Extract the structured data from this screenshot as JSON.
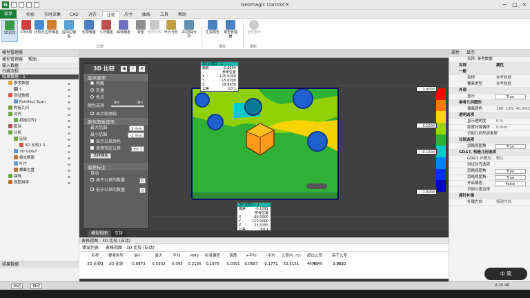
{
  "app": {
    "title": "Geomagic Control X",
    "logo_letter": "G"
  },
  "tabs": [
    {
      "label": "菜单"
    },
    {
      "label": "初始"
    },
    {
      "label": "实时采集"
    },
    {
      "label": "CAD"
    },
    {
      "label": "对齐"
    },
    {
      "label": "比较"
    },
    {
      "label": "尺寸"
    },
    {
      "label": "曲线"
    },
    {
      "label": "工具"
    },
    {
      "label": "帮助"
    }
  ],
  "ribbon": {
    "buttons": [
      {
        "label": "3D比较",
        "icon": "compare-3d-icon"
      },
      {
        "label": "2D比较",
        "icon": "compare-2d-icon"
      },
      {
        "label": "比较点",
        "icon": "compare-point-icon"
      },
      {
        "label": "边界偏差",
        "icon": "boundary-deviation-icon"
      },
      {
        "label": "虚拟边偏差",
        "icon": "virtual-edge-icon"
      },
      {
        "label": "轮廓偏差",
        "icon": "contour-deviation-icon"
      },
      {
        "label": "几何偏差",
        "icon": "geometry-deviation-icon"
      },
      {
        "label": "曲线偏差",
        "icon": "curve-deviation-icon"
      },
      {
        "label": "钣金",
        "icon": "sheet-metal-icon"
      },
      {
        "label": "趋势比较",
        "icon": "trend-icon"
      },
      {
        "label": "叶片分析",
        "icon": "blade-icon"
      },
      {
        "label": "2D扭曲分析",
        "icon": "twist-icon"
      },
      {
        "label": "生成报告",
        "icon": "report-icon"
      },
      {
        "label": "报告管理器",
        "icon": "report-manager-icon"
      },
      {
        "label": "全部重新",
        "icon": "refresh-icon"
      }
    ],
    "groups": {
      "compare": "比较",
      "report": "报告",
      "update": "更新"
    }
  },
  "left_panel": {
    "title": "模型管理器",
    "tools": {
      "manager": "模型管理器",
      "help": "帮助"
    },
    "sections": [
      "输入数据",
      "扫描流程",
      "结果数据 - 1"
    ],
    "tree": [
      {
        "label": "参考数据",
        "level": 1,
        "color": "#d9a13b"
      },
      {
        "label": "1",
        "level": 2,
        "color": "#888888"
      },
      {
        "label": "测试数据",
        "level": 1,
        "color": "#d9534f"
      },
      {
        "label": "Partifact Scan",
        "level": 2,
        "color": "#5b9bd5"
      },
      {
        "label": "构造几何",
        "level": 1,
        "color": "#7a9a3a"
      },
      {
        "label": "对齐",
        "level": 1,
        "color": "#6ea845"
      },
      {
        "label": "初始对齐1",
        "level": 2,
        "color": "#6ea845"
      },
      {
        "label": "配对",
        "level": 1,
        "color": "#aa5555"
      },
      {
        "label": "分析",
        "level": 1,
        "color": "#6ea845"
      },
      {
        "label": "比较",
        "level": 2,
        "color": "#6ea845"
      },
      {
        "label": "3D 比较1",
        "level": 3,
        "color": "#d9534f",
        "suffix": "3"
      },
      {
        "label": "3D GD&T",
        "level": 2,
        "color": "#5b9bd5"
      },
      {
        "label": "相交断面",
        "level": 2,
        "color": "#c07030"
      },
      {
        "label": "叶片",
        "level": 2,
        "color": "#5b9bd5"
      },
      {
        "label": "横截位置",
        "level": 2,
        "color": "#c07030"
      },
      {
        "label": "曲线",
        "level": 1,
        "color": "#6ea845"
      },
      {
        "label": "视图排序",
        "level": 1,
        "color": "#c07030"
      }
    ],
    "bottom_title": "结果数据"
  },
  "compare_panel": {
    "title": "3D 比较",
    "display_header": "显示选项",
    "display_options": [
      {
        "label": "色图",
        "selected": true
      },
      {
        "label": "矢量",
        "selected": false
      },
      {
        "label": "色点",
        "selected": false
      }
    ],
    "color_steps_label": "颜色选项",
    "slider_min": "最小",
    "slider_max": "最大",
    "show_contour": "显示轮廓线",
    "color_header": "颜色面板选项",
    "max_range_label": "最大范围",
    "max_range": "1 mm",
    "min_range_label": "最小范围",
    "min_range": "-1 mm",
    "show_tolerance": "显示公差颜色",
    "use_tolerance": "使用指定公差",
    "tolerance_value": "±0.1",
    "select_template": "选择模板",
    "annotation_header": "偏差标注",
    "auto_label": "自动",
    "above_tol": "高于公差的数量",
    "below_tol": "低于公差的数量",
    "above_val": "0",
    "below_val": "0"
  },
  "callouts": [
    {
      "title": "3D 比较1 - 1",
      "rows": [
        {
          "k": "偏差",
          "v": "-0.0604"
        },
        {
          "k": "",
          "v": "参考位置"
        },
        {
          "k": "X",
          "v": "-125.0000"
        },
        {
          "k": "Y",
          "v": "-15.0000"
        },
        {
          "k": "Z",
          "v": "29.9658"
        },
        {
          "k": "公差",
          "v": "±0.1"
        }
      ]
    },
    {
      "title": "3D 比较1 - 2",
      "rows": [
        {
          "k": "偏差",
          "v": "-0.1091"
        },
        {
          "k": "",
          "v": "参考位置"
        },
        {
          "k": "X",
          "v": "-90.0000"
        },
        {
          "k": "Y",
          "v": "-110.0000"
        },
        {
          "k": "Z",
          "v": "21.3155"
        },
        {
          "k": "公差",
          "v": "±0.1"
        }
      ]
    }
  ],
  "color_scale": {
    "labels": [
      "1.0000",
      "0.1000",
      "-0.1000",
      "-1.0000"
    ],
    "colors": [
      "#ff0000",
      "#ff7a00",
      "#ffd400",
      "#9bd400",
      "#2fb037",
      "#00c8c8",
      "#0080ff",
      "#0030ff",
      "#0000c0"
    ]
  },
  "right_panel": {
    "title": "属性",
    "subtitle": "显示",
    "name_label": "名称: 参考数据",
    "col_headers": [
      "名称",
      "属性"
    ],
    "sections": [
      {
        "title": "一般",
        "rows": [
          {
            "k": "名称",
            "v": "参考数据"
          },
          {
            "k": "要素类型",
            "v": "参考数据"
          }
        ]
      },
      {
        "title": "外观",
        "rows": [
          {
            "k": "显示",
            "v": "True",
            "box": true
          }
        ]
      },
      {
        "title": "参考几何图形",
        "rows": [
          {
            "k": "偏离颜色",
            "v": "160, 120, 40,0001"
          }
        ]
      },
      {
        "title": "透明选项",
        "rows": [
          {
            "k": "显示透明度",
            "v": "0 %"
          },
          {
            "k": "厚度补偿偏移",
            "v": "0 mm"
          },
          {
            "k": "识别几何形状类型",
            "v": ""
          }
        ]
      },
      {
        "title": "比较选项",
        "rows": [
          {
            "k": "忽略视图角",
            "v": "True",
            "box": true
          }
        ]
      },
      {
        "title": "GD&T, 构造几何选项",
        "rows": [
          {
            "k": "GD&T 计算方...",
            "v": "默认"
          },
          {
            "k": "测试对齐选项",
            "v": ""
          },
          {
            "k": "忽略视图角",
            "v": "True",
            "box": true
          },
          {
            "k": "忽略视图角",
            "v": "True",
            "box": true
          },
          {
            "k": "开启偏差...",
            "v": "False",
            "box": true
          },
          {
            "k": "识别公差边带",
            "v": ""
          }
        ]
      },
      {
        "title": "探针补偿",
        "rows": [
          {
            "k": "补偿方向",
            "v": "探测方向"
          }
        ]
      }
    ]
  },
  "bottom_tabs": [
    {
      "label": "模型视图"
    },
    {
      "label": "支持"
    }
  ],
  "table": {
    "title": "表格视图 - 3D 比较 (自动)",
    "error_label": "错误列表",
    "view_label": "表格视图 - 3D 比较 (自动)",
    "headers": [
      "名称",
      "要素类型",
      "最小",
      "最大",
      "平均",
      "RMS",
      "标准偏差",
      "离散",
      "+平均",
      "-平均",
      "公差内 (%)",
      "超出公差 (%)",
      "高于公差 (%)"
    ],
    "rows": [
      [
        "3D 比较1",
        "3D 比较",
        "-0.8873",
        "0.5932",
        "-0.095",
        "0.2195",
        "0.1979",
        "0.0391",
        "0.0887",
        "-0.1771",
        "53.5151",
        "46.4849",
        "9.0032"
      ]
    ]
  },
  "statusbar": {
    "mode1": "自动",
    "mode2": "自动",
    "coords": "0.25.46"
  },
  "widget": {
    "text": "中 简"
  }
}
